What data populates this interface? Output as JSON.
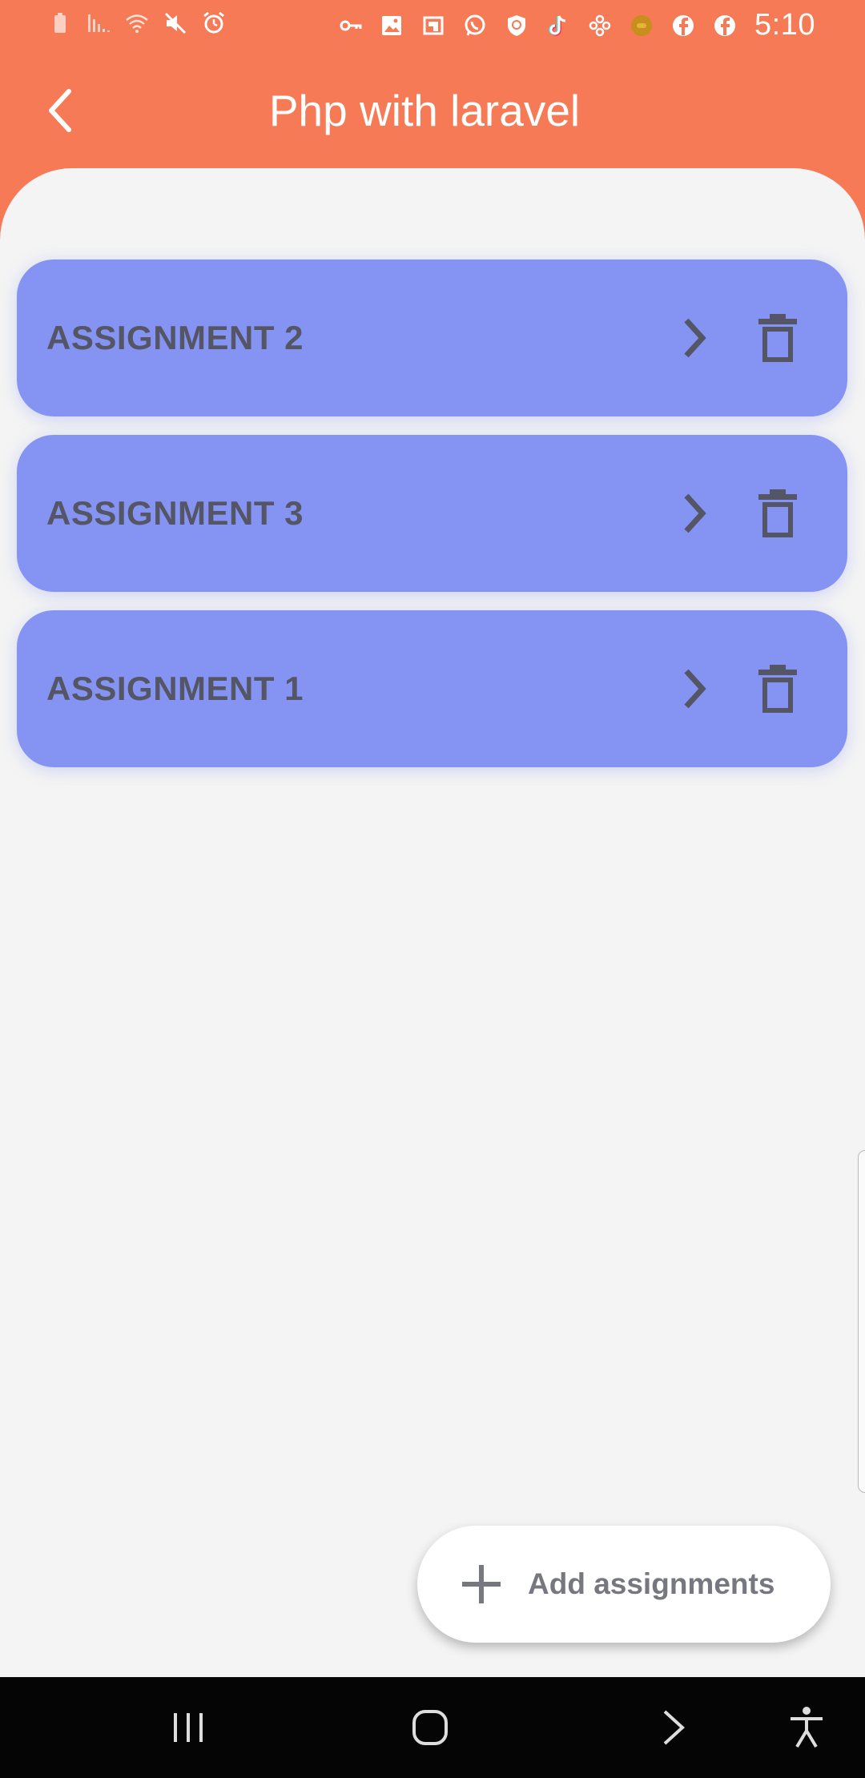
{
  "statusbar": {
    "time": "5:10",
    "left_icons": [
      "battery-icon",
      "signal-icon",
      "wifi-icon",
      "mute-icon",
      "alarm-icon"
    ],
    "right_icons": [
      "vpn-key-icon",
      "gallery-icon",
      "flipboard-icon",
      "whatsapp-icon",
      "shield-icon",
      "tiktok-icon",
      "app-icon",
      "coin-icon",
      "facebook-icon",
      "facebook-icon"
    ]
  },
  "header": {
    "title": "Php with laravel",
    "back_icon": "chevron-left-icon"
  },
  "assignments": [
    {
      "title": "ASSIGNMENT 2"
    },
    {
      "title": "ASSIGNMENT 3"
    },
    {
      "title": "ASSIGNMENT 1"
    }
  ],
  "fab": {
    "label": "Add assignments",
    "icon": "plus-icon"
  },
  "navbar": {
    "icons": [
      "recent-apps-icon",
      "home-icon",
      "back-icon",
      "accessibility-icon"
    ]
  },
  "colors": {
    "header": "#f67a55",
    "card": "#8594f3",
    "card_text": "#555665",
    "background": "#f4f4f4",
    "navbar": "#050505"
  }
}
